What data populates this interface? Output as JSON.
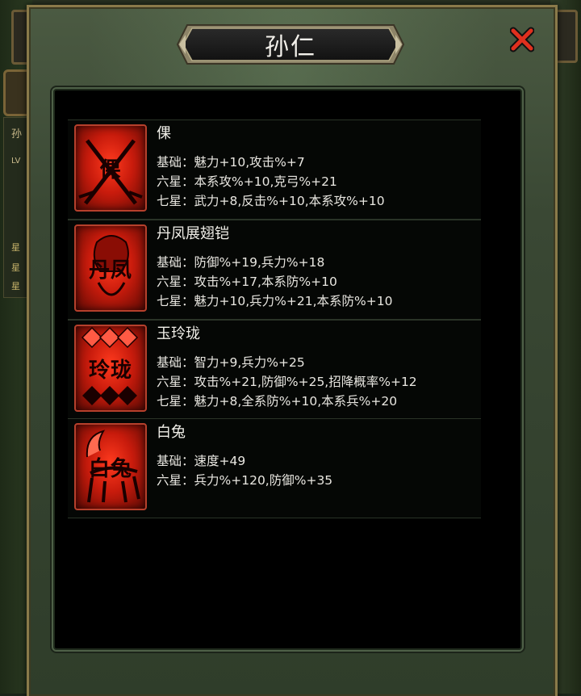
{
  "modal": {
    "title": "孙仁"
  },
  "background": {
    "left_glyphs": [
      "孙",
      "LV",
      "星",
      "星",
      "星"
    ]
  },
  "items": [
    {
      "name": "倮",
      "icon_label": "倮",
      "lines": [
        "基础：魅力+10,攻击%+7",
        "六星：本系攻%+10,克弓%+21",
        "七星：武力+8,反击%+10,本系攻%+10"
      ]
    },
    {
      "name": "丹凤展翅铠",
      "icon_label": "丹凤",
      "lines": [
        "基础：防御%+19,兵力%+18",
        "六星：攻击%+17,本系防%+10",
        "七星：魅力+10,兵力%+21,本系防%+10"
      ]
    },
    {
      "name": "玉玲珑",
      "icon_label": "玲珑",
      "lines": [
        "基础：智力+9,兵力%+25",
        "六星：攻击%+21,防御%+25,招降概率%+12",
        "七星：魅力+8,全系防%+10,本系兵%+20"
      ]
    },
    {
      "name": "白兔",
      "icon_label": "白兔",
      "lines": [
        "基础：速度+49",
        "六星：兵力%+120,防御%+35"
      ]
    }
  ],
  "colors": {
    "icon_red": "#d0200e",
    "panel_bg": "#000000",
    "frame_gold": "#8a7a4a"
  }
}
